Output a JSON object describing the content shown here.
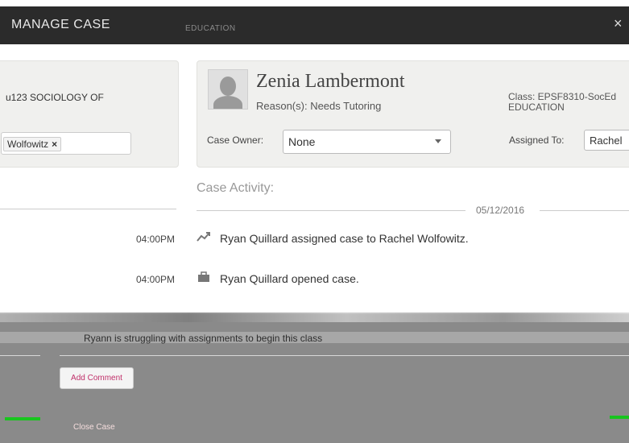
{
  "window": {
    "title": "MANAGE CASE",
    "subtitle": "EDUCATION",
    "close_glyph": "×"
  },
  "left_panel": {
    "course": "u123 SOCIOLOGY OF",
    "token": "Wolfowitz",
    "token_remove": "×"
  },
  "student": {
    "name": "Zenia Lambermont",
    "reason": "Reason(s): Needs Tutoring",
    "class_line1": "Class: EPSF8310-SocEd",
    "class_line2": "EDUCATION",
    "case_owner_label": "Case Owner:",
    "case_owner_value": "None",
    "assigned_to_label": "Assigned To:",
    "assigned_to_value": "Rachel"
  },
  "activity": {
    "title": "Case Activity:",
    "date": "05/12/2016",
    "items": [
      {
        "time": "04:00PM",
        "icon": "trend-icon",
        "text": "Ryan Quillard assigned case to Rachel Wolfowitz."
      },
      {
        "time": "04:00PM",
        "icon": "briefcase-icon",
        "text": "Ryan Quillard opened case."
      }
    ]
  },
  "comment": {
    "text": "Ryann is struggling with assignments to begin this class",
    "add_button": "Add Comment"
  },
  "footer": {
    "close_case": "Close Case"
  },
  "colors": {
    "titlebar": "#2b2b2b",
    "panel": "#f0f0ee",
    "accent": "#c0306a",
    "overlay": "#8a8a8a",
    "green": "#18c51e"
  }
}
